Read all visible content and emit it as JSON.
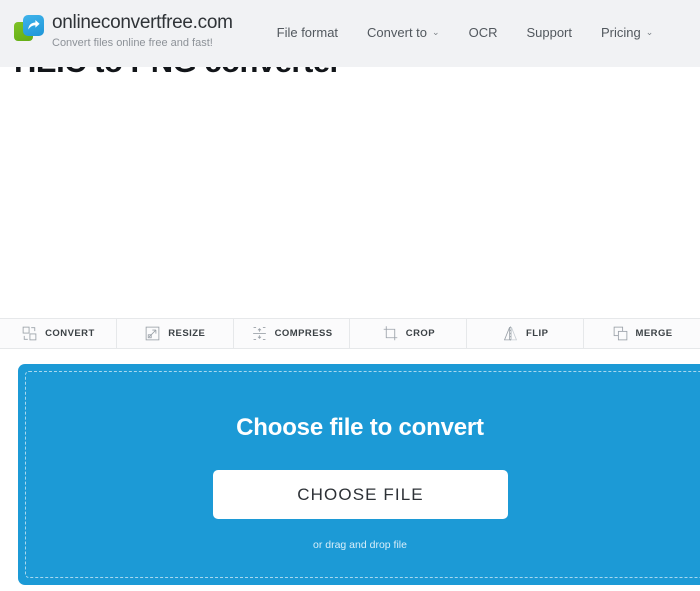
{
  "header": {
    "brand_name": "onlineconvertfree.com",
    "brand_tagline": "Convert files online free and fast!",
    "logo_icon": "convert-arrow-logo",
    "nav": [
      {
        "label": "File format",
        "has_caret": false,
        "caret": ""
      },
      {
        "label": "Convert to",
        "has_caret": true,
        "caret": "⌄"
      },
      {
        "label": "OCR",
        "has_caret": false,
        "caret": ""
      },
      {
        "label": "Support",
        "has_caret": false,
        "caret": ""
      },
      {
        "label": "Pricing",
        "has_caret": true,
        "caret": "⌄"
      }
    ]
  },
  "page": {
    "title": "HEIC to PNG converter"
  },
  "toolbar": {
    "items": [
      {
        "label": "CONVERT",
        "icon": "convert-icon"
      },
      {
        "label": "RESIZE",
        "icon": "resize-icon"
      },
      {
        "label": "COMPRESS",
        "icon": "compress-icon"
      },
      {
        "label": "CROP",
        "icon": "crop-icon"
      },
      {
        "label": "FLIP",
        "icon": "flip-icon"
      },
      {
        "label": "MERGE",
        "icon": "merge-icon"
      }
    ]
  },
  "dropzone": {
    "title": "Choose file to convert",
    "button_label": "CHOOSE FILE",
    "hint": "or drag and drop file",
    "background_color": "#1c9ad6",
    "button_color": "#ffffff"
  },
  "colors": {
    "header_bg": "#f1f2f4",
    "accent_blue": "#1c9ad6",
    "logo_green": "#6fb81b",
    "logo_blue": "#2e9fdc",
    "text_dark": "#2f3337",
    "text_muted": "#8d9298"
  }
}
